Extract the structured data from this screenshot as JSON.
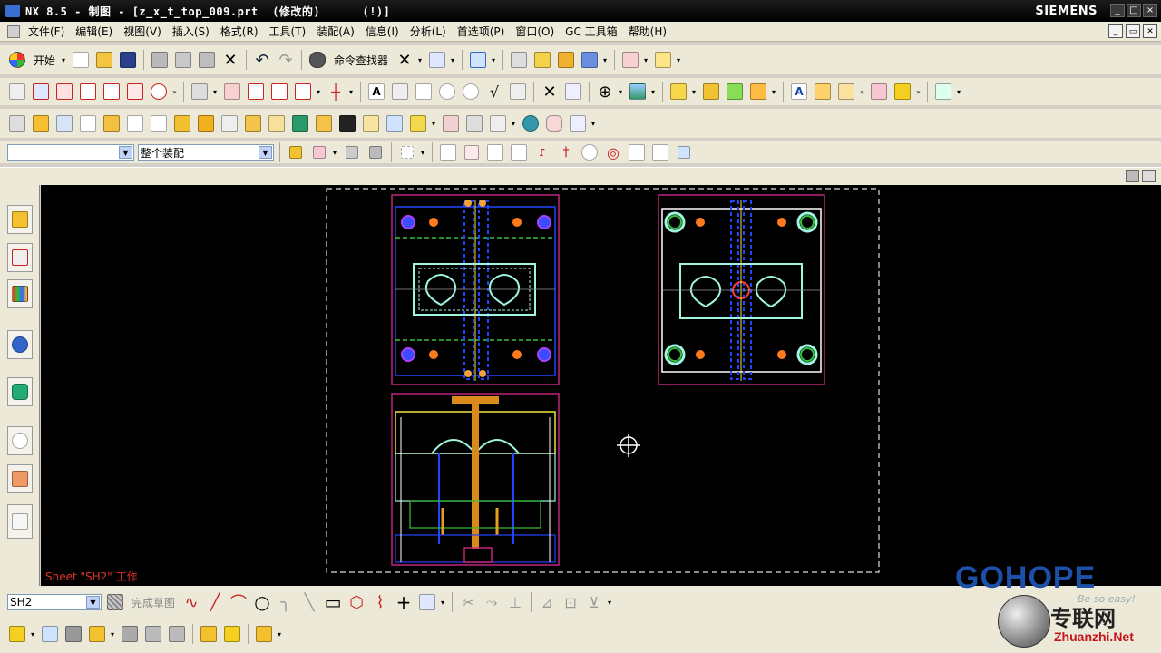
{
  "window": {
    "title": "NX 8.5 - 制图 - [z_x_t_top_009.prt  (修改的)      (!)]",
    "brand": "SIEMENS",
    "controls": [
      "_",
      "□",
      "×"
    ]
  },
  "menubar": {
    "items": [
      "文件(F)",
      "编辑(E)",
      "视图(V)",
      "插入(S)",
      "格式(R)",
      "工具(T)",
      "装配(A)",
      "信息(I)",
      "分析(L)",
      "首选项(P)",
      "窗口(O)",
      "GC 工具箱",
      "帮助(H)"
    ]
  },
  "toolbar1": {
    "start_label": "开始",
    "command_finder_label": "命令查找器"
  },
  "toolbar4": {
    "filter_value": "",
    "scope_value": "整个装配"
  },
  "canvas": {
    "sheet_label": "Sheet \"SH2\" 工作"
  },
  "bottombar": {
    "sheet_select_value": "SH2",
    "finish_sketch_label": "完成草图"
  },
  "watermark": {
    "brand": "GOHOPE",
    "tagline": "Be so easy!",
    "site_cn": "专联网",
    "site_url": "Zhuanzhi.Net"
  },
  "colors": {
    "canvas_bg": "#000000",
    "frame_magenta": "#c0267e",
    "drawing_cyan": "#9ff5e0",
    "drawing_blue": "#2244ff",
    "drawing_yellow": "#f2e23a",
    "drawing_orange": "#ff7a1a",
    "drawing_green": "#36c13a",
    "brand_blue": "#1d4fa8",
    "sheet_label_red": "#e0342a"
  }
}
